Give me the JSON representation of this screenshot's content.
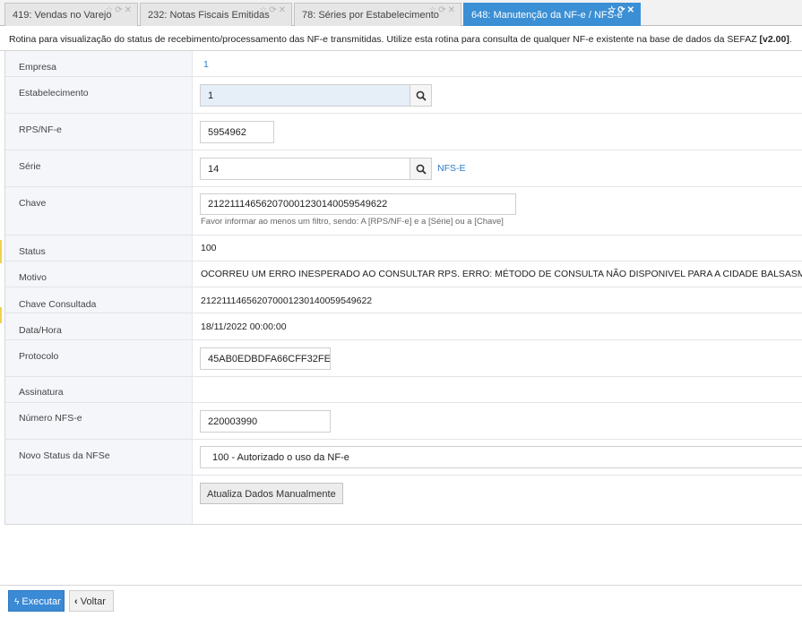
{
  "tabs": [
    {
      "label": "419: Vendas no Varejo"
    },
    {
      "label": "232: Notas Fiscais Emitidas"
    },
    {
      "label": "78: Séries por Estabelecimento"
    },
    {
      "label": "648: Manutenção da NF-e / NFS-e"
    }
  ],
  "description": {
    "text": "Rotina para visualização do status de recebimento/processamento das NF-e transmitidas. Utilize esta rotina para consulta de qualquer NF-e existente na base de dados da SEFAZ ",
    "version": "[v2.00]",
    "end": "."
  },
  "form": {
    "empresa": {
      "label": "Empresa",
      "value": "1"
    },
    "estabelecimento": {
      "label": "Estabelecimento",
      "value": "1"
    },
    "rps": {
      "label": "RPS/NF-e",
      "value": "5954962"
    },
    "serie": {
      "label": "Série",
      "value": "14",
      "desc": "NFS-E"
    },
    "chave": {
      "label": "Chave",
      "value": "21221114656207000123014005954962 2",
      "hint": "Favor informar ao menos um filtro, sendo: A [RPS/NF-e] e a [Série] ou a [Chave]"
    },
    "status": {
      "label": "Status",
      "value": "100"
    },
    "motivo": {
      "label": "Motivo",
      "value": "OCORREU UM ERRO INESPERADO AO CONSULTAR RPS. ERRO: MÉTODO DE CONSULTA NÃO DISPONIVEL PARA A CIDADE BALSASMA."
    },
    "chave_consultada": {
      "label": "Chave Consultada",
      "value": "212211146562070001230140059549622"
    },
    "data_hora": {
      "label": "Data/Hora",
      "value": "18/11/2022 00:00:00"
    },
    "protocolo": {
      "label": "Protocolo",
      "value": "45AB0EDBDFA66CFF32FE"
    },
    "assinatura": {
      "label": "Assinatura"
    },
    "numero_nfse": {
      "label": "Número NFS-e",
      "value": "220003990"
    },
    "novo_status": {
      "label": "Novo Status da NFSe",
      "value": "100 - Autorizado o uso da NF-e"
    },
    "atualiza_button": "Atualiza Dados Manualmente"
  },
  "footer": {
    "execute_label": "Executar",
    "back_label": "Voltar"
  },
  "colors": {
    "accent": "#3b8fd4",
    "link": "#2a7bc4"
  }
}
